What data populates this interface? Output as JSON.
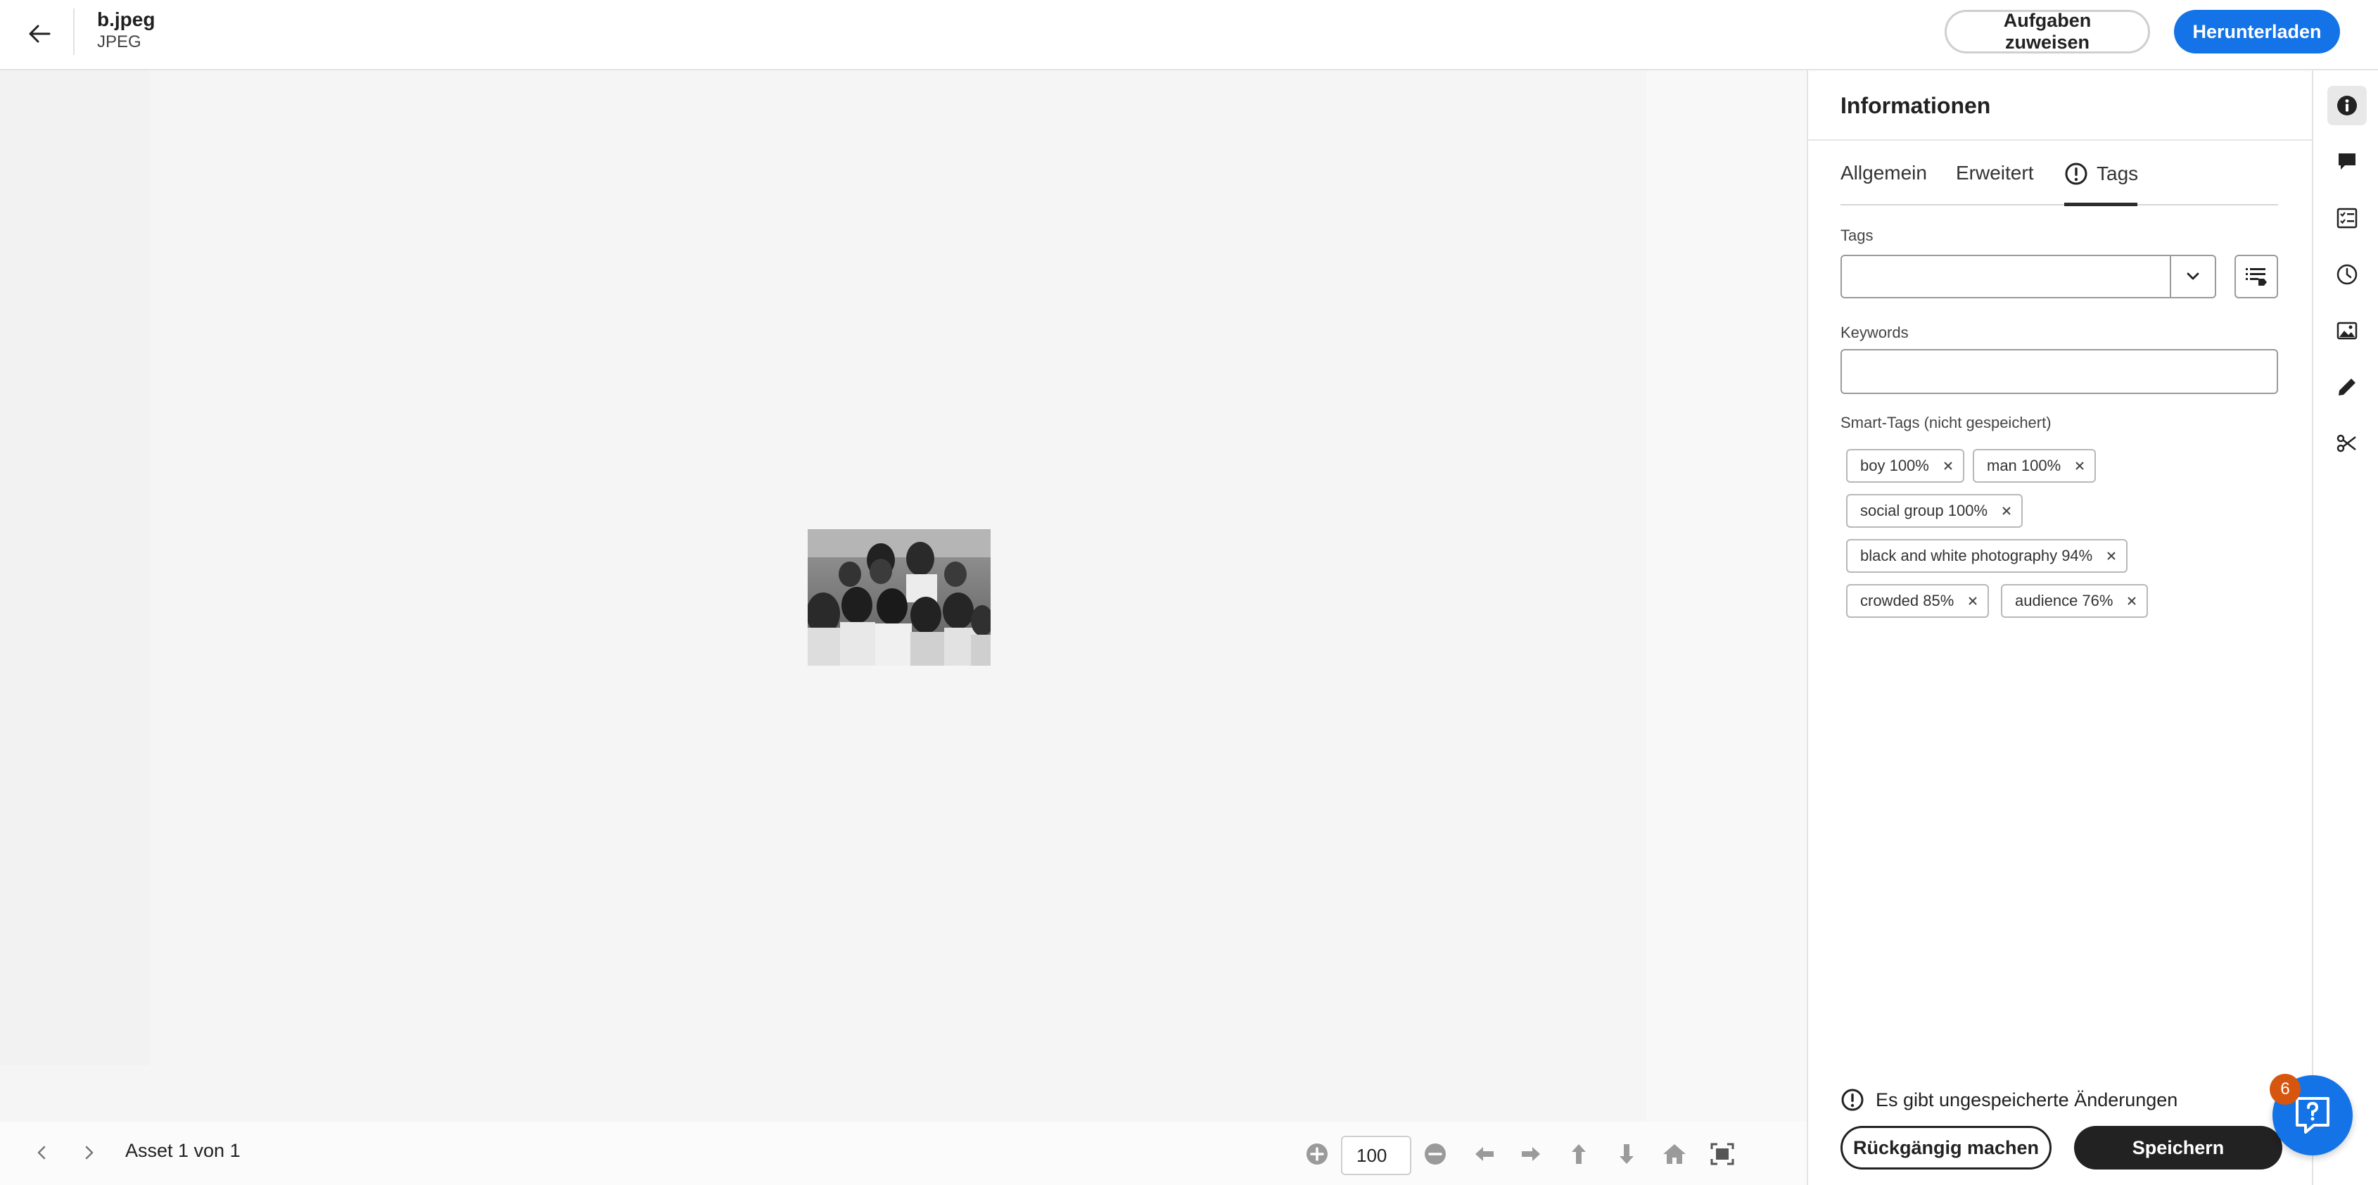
{
  "header": {
    "file_name": "b.jpeg",
    "file_type": "JPEG",
    "assign_tasks_label": "Aufgaben zuweisen",
    "download_label": "Herunterladen"
  },
  "viewer": {
    "asset_count": "Asset 1 von 1",
    "zoom_value": "100"
  },
  "panel": {
    "title": "Informationen",
    "tabs": [
      {
        "label": "Allgemein",
        "active": false
      },
      {
        "label": "Erweitert",
        "active": false
      },
      {
        "label": "Tags",
        "active": true,
        "icon": "alert-circle-icon"
      }
    ],
    "tags_label": "Tags",
    "tags_value": "",
    "keywords_label": "Keywords",
    "keywords_value": "",
    "smart_tags_label": "Smart-Tags (nicht gespeichert)",
    "smart_tags": [
      "boy 100%",
      "man 100%",
      "social group 100%",
      "black and white photography 94%",
      "crowded 85%",
      "audience 76%"
    ],
    "unsaved_message": "Es gibt ungespeicherte Änderungen",
    "undo_label": "Rückgängig machen",
    "save_label": "Speichern"
  },
  "rail": {
    "items": [
      "info-icon",
      "comment-icon",
      "tasks-icon",
      "history-icon",
      "image-icon",
      "edit-icon",
      "cut-icon"
    ],
    "active": "info-icon"
  },
  "help": {
    "badge_count": "6"
  },
  "colors": {
    "accent": "#1473e6",
    "badge": "#d7560f",
    "dark_button": "#222222"
  }
}
